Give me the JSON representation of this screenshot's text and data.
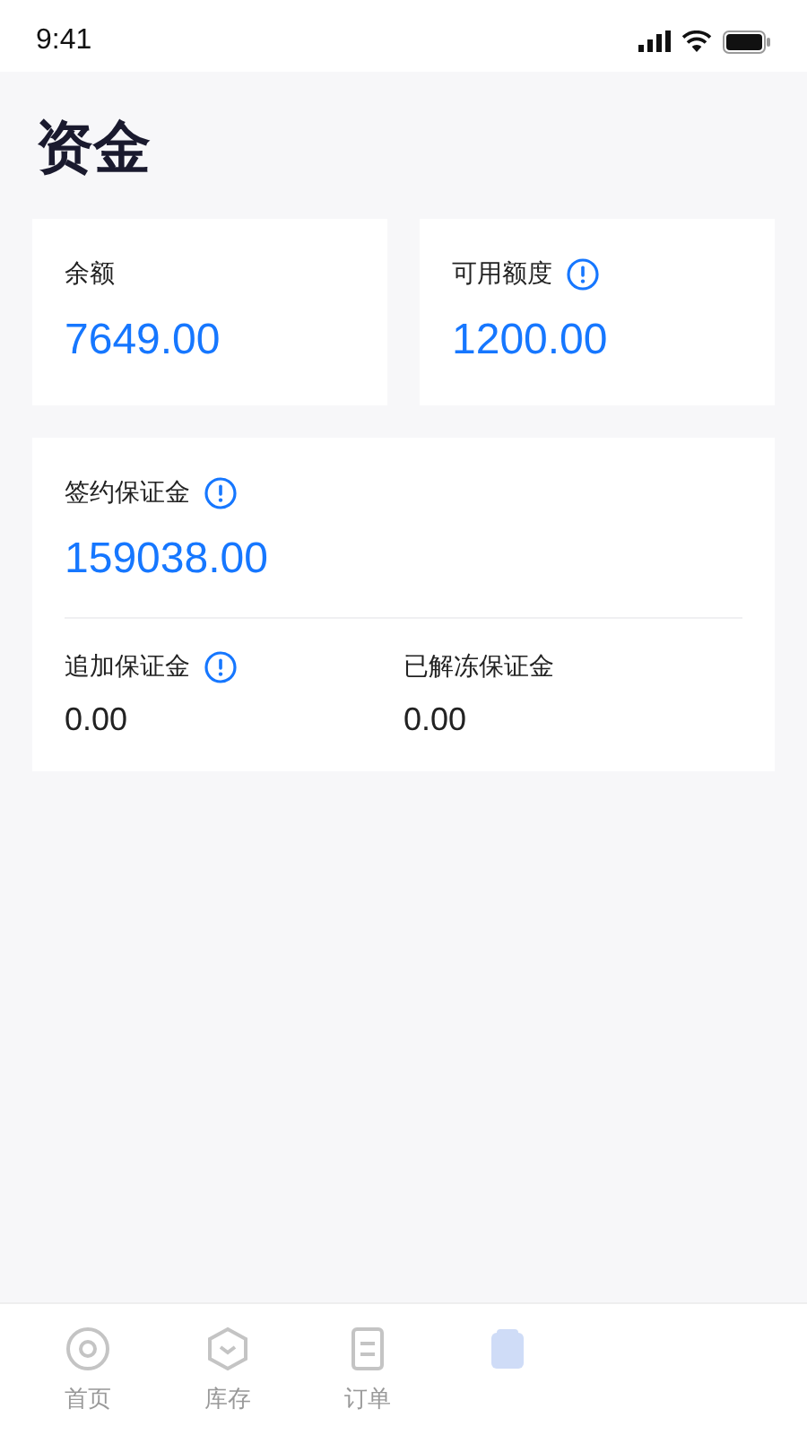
{
  "status_bar": {
    "time": "9:41"
  },
  "title": "资金",
  "summary_cards": [
    {
      "label": "余额",
      "value": "7649.00",
      "info": false
    },
    {
      "label": "可用额度",
      "value": "1200.00",
      "info": true
    }
  ],
  "deposit_card": {
    "label": "签约保证金",
    "value": "159038.00",
    "info": true,
    "items": [
      {
        "label": "追加保证金",
        "value": "0.00",
        "info": true
      },
      {
        "label": "已解冻保证金",
        "value": "0.00",
        "info": false
      }
    ]
  },
  "tab_bar": [
    {
      "kind": "home",
      "label": "首页",
      "selected": false
    },
    {
      "kind": "stock",
      "label": "库存",
      "selected": false
    },
    {
      "kind": "order",
      "label": "订单",
      "selected": false
    },
    {
      "kind": "wallet",
      "selected": true
    }
  ]
}
